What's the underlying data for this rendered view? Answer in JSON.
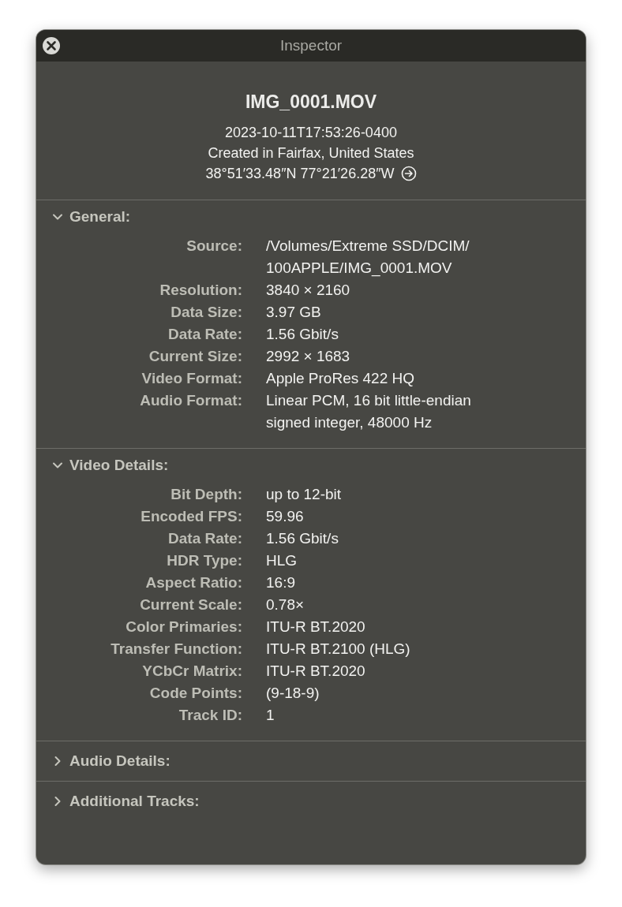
{
  "window": {
    "title": "Inspector"
  },
  "header": {
    "filename": "IMG_0001.MOV",
    "timestamp": "2023-10-11T17:53:26-0400",
    "location": "Created in Fairfax, United States",
    "coordinates": "38°51′33.48″N 77°21′26.28″W"
  },
  "sections": [
    {
      "title": "General:",
      "expanded": true,
      "rows": [
        {
          "label": "Source:",
          "value": "/Volumes/Extreme SSD/DCIM/\n100APPLE/IMG_0001.MOV"
        },
        {
          "label": "Resolution:",
          "value": "3840 × 2160"
        },
        {
          "label": "Data Size:",
          "value": "3.97 GB"
        },
        {
          "label": "Data Rate:",
          "value": "1.56 Gbit/s"
        },
        {
          "label": "Current Size:",
          "value": "2992 × 1683"
        },
        {
          "label": "Video Format:",
          "value": "Apple ProRes 422 HQ"
        },
        {
          "label": "Audio Format:",
          "value": "Linear PCM, 16 bit little-endian\nsigned integer, 48000 Hz"
        }
      ]
    },
    {
      "title": "Video Details:",
      "expanded": true,
      "rows": [
        {
          "label": "Bit Depth:",
          "value": "up to 12-bit"
        },
        {
          "label": "Encoded FPS:",
          "value": "59.96"
        },
        {
          "label": "Data Rate:",
          "value": "1.56 Gbit/s"
        },
        {
          "label": "HDR Type:",
          "value": "HLG"
        },
        {
          "label": "Aspect Ratio:",
          "value": "16:9"
        },
        {
          "label": "Current Scale:",
          "value": "0.78×"
        },
        {
          "label": "Color Primaries:",
          "value": "ITU-R BT.2020"
        },
        {
          "label": "Transfer Function:",
          "value": "ITU-R BT.2100 (HLG)"
        },
        {
          "label": "YCbCr Matrix:",
          "value": "ITU-R BT.2020"
        },
        {
          "label": "Code Points:",
          "value": "(9-18-9)"
        },
        {
          "label": "Track ID:",
          "value": "1"
        }
      ]
    },
    {
      "title": "Audio Details:",
      "expanded": false
    },
    {
      "title": "Additional Tracks:",
      "expanded": false
    }
  ]
}
